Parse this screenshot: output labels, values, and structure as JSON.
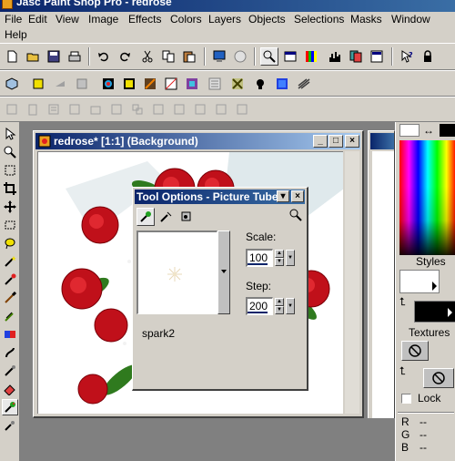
{
  "app": {
    "title": "Jasc Paint Shop Pro - redrose"
  },
  "menu": {
    "items": [
      {
        "label": "File"
      },
      {
        "label": "Edit"
      },
      {
        "label": "View"
      },
      {
        "label": "Image"
      },
      {
        "label": "Effects"
      },
      {
        "label": "Colors"
      },
      {
        "label": "Layers"
      },
      {
        "label": "Objects"
      },
      {
        "label": "Selections"
      },
      {
        "label": "Masks"
      },
      {
        "label": "Window"
      },
      {
        "label": "Help"
      }
    ]
  },
  "image_window": {
    "title": "redrose* [1:1] (Background)"
  },
  "tool_options": {
    "title": "Tool Options - Picture Tube",
    "tube_name": "spark2",
    "scale_label": "Scale:",
    "scale_value": "100",
    "step_label": "Step:",
    "step_value": "200"
  },
  "color_palette": {
    "styles_label": "Styles",
    "textures_label": "Textures",
    "lock_label": "Lock",
    "readouts": [
      {
        "channel": "R",
        "value": "--"
      },
      {
        "channel": "G",
        "value": "--"
      },
      {
        "channel": "B",
        "value": "--"
      }
    ]
  },
  "colors": {
    "titlebar_active": "#0a246a",
    "face": "#d4d0c8",
    "desktop": "#808080"
  }
}
